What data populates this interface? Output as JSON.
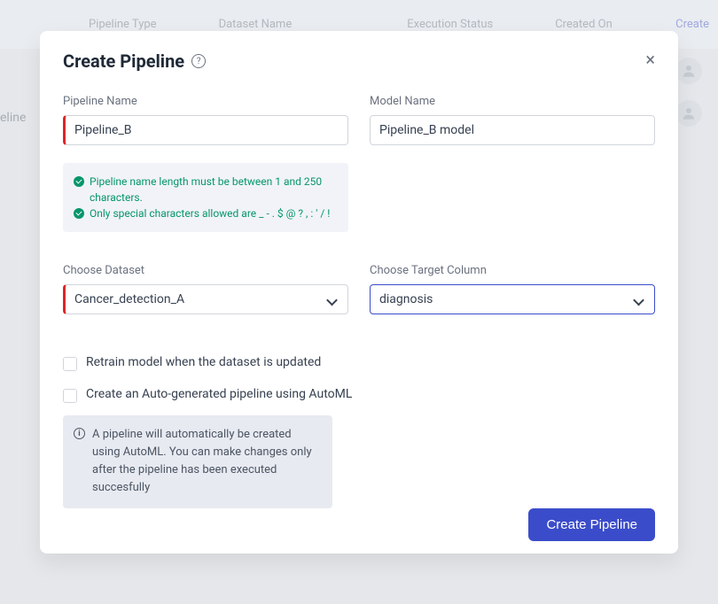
{
  "bg": {
    "col1": "Pipeline Type",
    "col2": "Dataset Name",
    "col3": "Execution Status",
    "col4": "Created On",
    "create_link": "Create",
    "row1": "eline"
  },
  "modal": {
    "title": "Create Pipeline",
    "close": "×",
    "pipeline_name": {
      "label": "Pipeline Name",
      "value": "Pipeline_B"
    },
    "model_name": {
      "label": "Model Name",
      "value": "Pipeline_B model"
    },
    "validation": {
      "msg1": "Pipeline name length must be between 1 and 250 characters.",
      "msg2": "Only special characters allowed are _ - . $ @ ? , : ' / !"
    },
    "dataset": {
      "label": "Choose Dataset",
      "value": "Cancer_detection_A"
    },
    "target": {
      "label": "Choose Target Column",
      "value": "diagnosis"
    },
    "retrain_label": "Retrain model when the dataset is updated",
    "automl_label": "Create an Auto-generated pipeline using AutoML",
    "info_text": "A pipeline will automatically be created using AutoML. You can make changes only after the pipeline has been executed succesfully",
    "submit_label": "Create Pipeline"
  }
}
